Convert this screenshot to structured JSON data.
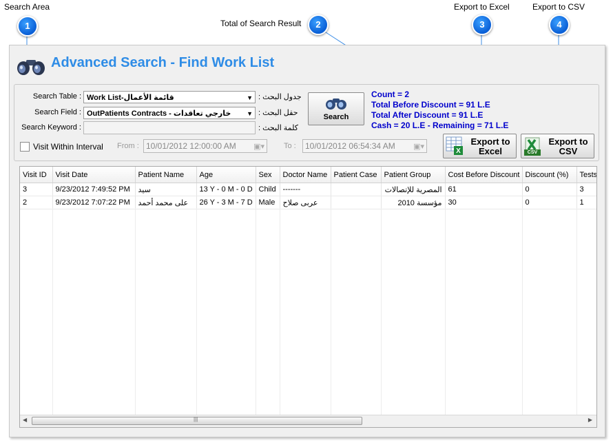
{
  "callouts": [
    {
      "num": "1",
      "label": "Search Area"
    },
    {
      "num": "2",
      "label": "Total of Search Result"
    },
    {
      "num": "3",
      "label": "Export to Excel"
    },
    {
      "num": "4",
      "label": "Export to CSV"
    }
  ],
  "window": {
    "title": "Advanced Search - Find Work List"
  },
  "search": {
    "table_label": "Search Table :",
    "table_value": "Work List-قائمة الأعمال",
    "table_label_ar": ": جدول البحث",
    "field_label": "Search Field :",
    "field_value": "OutPatients Contracts  -  خارجي تعاقدات",
    "field_label_ar": ": حقل البحث",
    "keyword_label": "Search Keyword :",
    "keyword_value": "",
    "keyword_label_ar": ": كلمة البحث",
    "interval_label": "Visit Within Interval",
    "from_label": "From :",
    "from_value": "10/01/2012 12:00:00 AM",
    "to_label": "To :",
    "to_value": "10/01/2012 06:54:34 AM",
    "search_button": "Search"
  },
  "summary": {
    "count": "Count = 2",
    "before": "Total Before Discount = 91 L.E",
    "after": "Total After Discount = 91 L.E",
    "cash": "Cash = 20 L.E - Remaining = 71 L.E"
  },
  "export": {
    "excel_line1": "Export to",
    "excel_line2": "Excel",
    "csv_line1": "Export to",
    "csv_line2": "CSV",
    "csv_icon_text": "CSV"
  },
  "grid": {
    "columns": [
      "Visit ID",
      "Visit Date",
      "Patient Name",
      "Age",
      "Sex",
      "Doctor Name",
      "Patient Case",
      "Patient Group",
      "Cost Before Discount",
      "Discount (%)",
      "Tests"
    ],
    "rows": [
      [
        "3",
        "9/23/2012 7:49:52 PM",
        "سيد",
        "13 Y - 0 M - 0 D",
        "Child",
        "-------",
        "",
        "المصرية للإتصالات",
        "61",
        "0",
        "3"
      ],
      [
        "2",
        "9/23/2012 7:07:22 PM",
        "على محمد أحمد",
        "26 Y - 3 M - 7 D",
        "Male",
        "عربى صلاح",
        "",
        "مؤسسة 2010",
        "30",
        "0",
        "1"
      ]
    ]
  }
}
